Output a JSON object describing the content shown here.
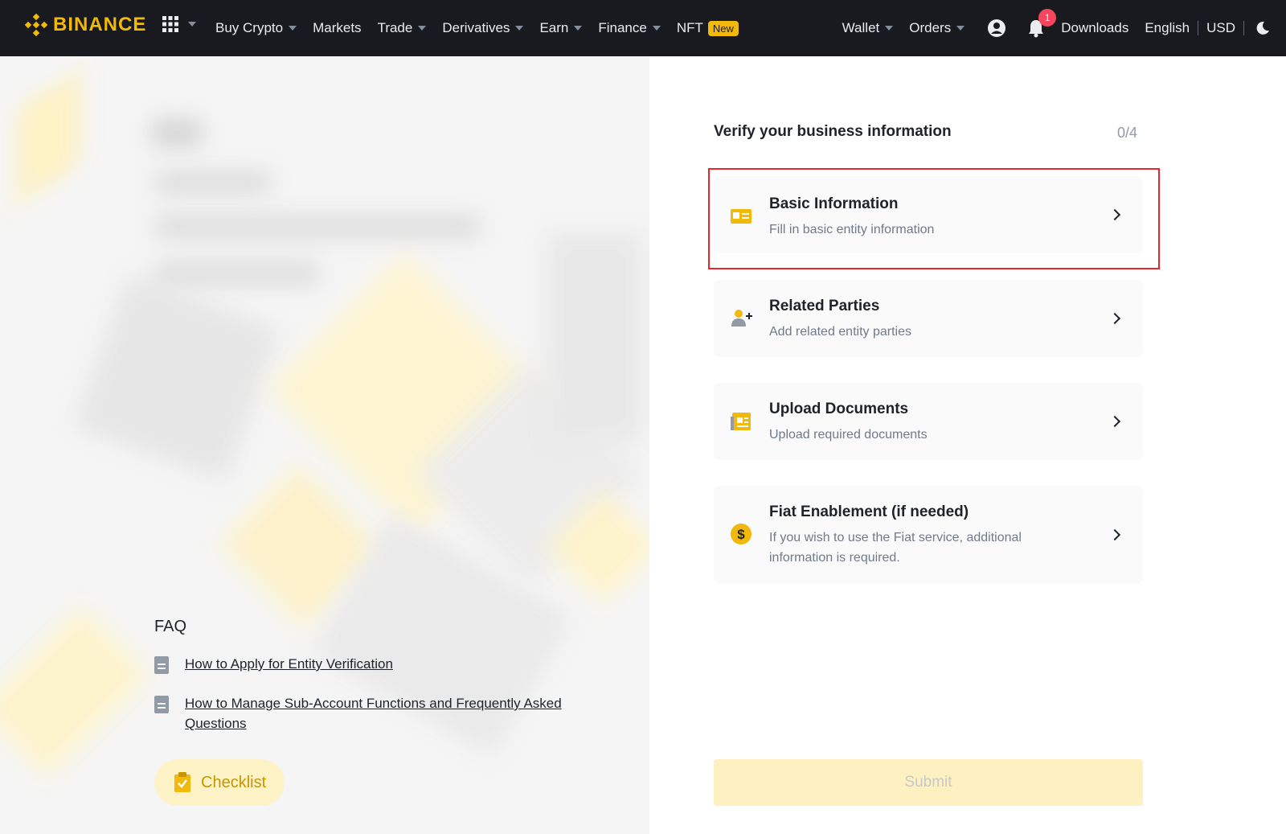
{
  "brand": {
    "name": "BINANCE",
    "color": "#f0b90b"
  },
  "nav": {
    "items": [
      {
        "label": "Buy Crypto",
        "caret": true
      },
      {
        "label": "Markets",
        "caret": false
      },
      {
        "label": "Trade",
        "caret": true
      },
      {
        "label": "Derivatives",
        "caret": true
      },
      {
        "label": "Earn",
        "caret": true
      },
      {
        "label": "Finance",
        "caret": true
      },
      {
        "label": "NFT",
        "caret": false,
        "badge": "New"
      }
    ],
    "wallet": "Wallet",
    "orders": "Orders",
    "notification_count": "1",
    "downloads": "Downloads",
    "language": "English",
    "currency": "USD"
  },
  "left": {
    "faq": {
      "title": "FAQ",
      "links": [
        "How to Apply for Entity Verification",
        "How to Manage Sub-Account Functions and Frequently Asked Questions"
      ]
    },
    "checklist_label": "Checklist"
  },
  "verify": {
    "title": "Verify your business information",
    "progress": "0/4",
    "cards": [
      {
        "title": "Basic Information",
        "desc": "Fill in basic entity information",
        "icon": "id-card-icon"
      },
      {
        "title": "Related Parties",
        "desc": "Add related entity parties",
        "icon": "add-person-icon"
      },
      {
        "title": "Upload Documents",
        "desc": "Upload required documents",
        "icon": "document-icon"
      },
      {
        "title": "Fiat Enablement (if needed)",
        "desc": "If you wish to use the Fiat service, additional information is required.",
        "icon": "dollar-coin-icon"
      }
    ],
    "submit_label": "Submit"
  },
  "colors": {
    "accent": "#f0b90b",
    "highlight": "#e8262c",
    "nav_bg": "#181a20"
  }
}
